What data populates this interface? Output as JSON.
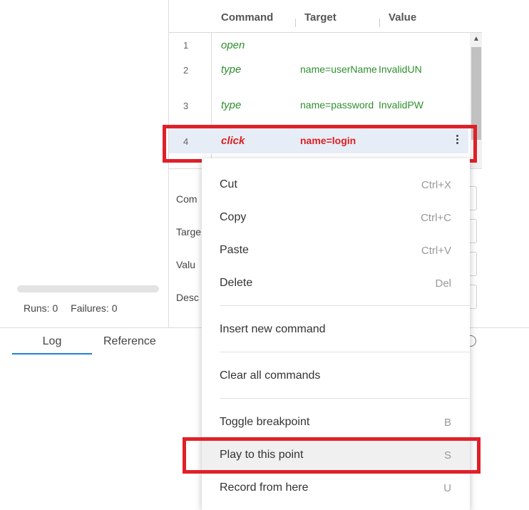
{
  "runs": {
    "runs_text": "Runs: 0",
    "failures_text": "Failures: 0"
  },
  "table": {
    "headers": {
      "command": "Command",
      "target": "Target",
      "value": "Value"
    },
    "rows": [
      {
        "num": "1",
        "command": "open",
        "target": "",
        "value": ""
      },
      {
        "num": "2",
        "command": "type",
        "target": "name=userName",
        "value": "InvalidUN"
      },
      {
        "num": "3",
        "command": "type",
        "target": "name=password",
        "value": "InvalidPW"
      },
      {
        "num": "4",
        "command": "click",
        "target": "name=login",
        "value": ""
      }
    ],
    "selected_row": "4"
  },
  "editor": {
    "labels": [
      "Com",
      "Targe",
      "Valu",
      "Desc"
    ]
  },
  "tabs": [
    {
      "label": "Log",
      "active": true
    },
    {
      "label": "Reference",
      "active": false
    }
  ],
  "context_menu": {
    "items": [
      {
        "label": "Cut",
        "shortcut": "Ctrl+X"
      },
      {
        "label": "Copy",
        "shortcut": "Ctrl+C"
      },
      {
        "label": "Paste",
        "shortcut": "Ctrl+V"
      },
      {
        "label": "Delete",
        "shortcut": "Del"
      },
      {
        "label": "Insert new command",
        "shortcut": ""
      },
      {
        "label": "Clear all commands",
        "shortcut": ""
      },
      {
        "label": "Toggle breakpoint",
        "shortcut": "B"
      },
      {
        "label": "Play to this point",
        "shortcut": "S"
      },
      {
        "label": "Record from here",
        "shortcut": "U"
      }
    ]
  },
  "colors": {
    "highlight_box": "#e02027",
    "selected_row_bg": "#e6edf7",
    "command_green": "#2f8f2f",
    "selected_red": "#dd1f1f",
    "tab_active": "#1f82d6"
  }
}
